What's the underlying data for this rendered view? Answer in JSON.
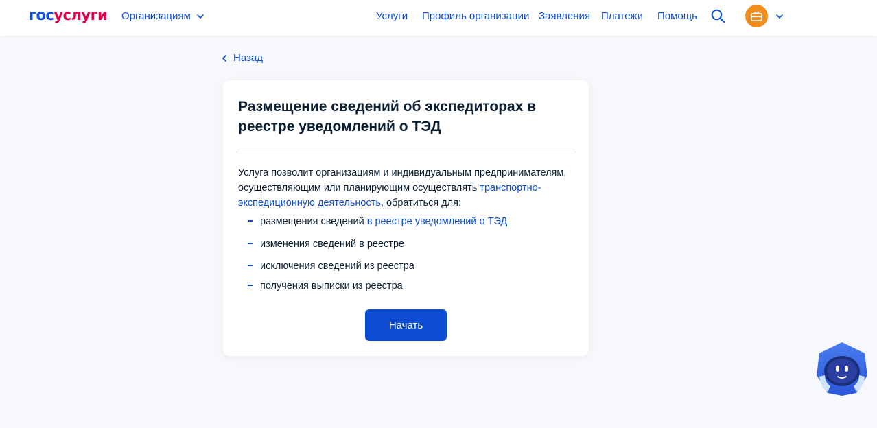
{
  "header": {
    "logo_part1": "гос",
    "logo_part2": "услуги",
    "org_menu_label": "Организациям",
    "nav": [
      {
        "label": "Услуги"
      },
      {
        "label": "Профиль организации"
      },
      {
        "label": "Заявления"
      },
      {
        "label": "Платежи"
      },
      {
        "label": "Помощь"
      }
    ],
    "search_icon": "search-icon",
    "avatar_icon": "briefcase-icon"
  },
  "back": {
    "label": "Назад"
  },
  "card": {
    "title": "Размещение сведений об экспедиторах в реестре уведомлений о ТЭД",
    "description_before_link": "Услуга позволит организациям и индивидуальным предпринимателям, осуществляющим или планирующим осуществлять ",
    "description_link": "транспортно-экспедиционную деятельность",
    "description_after_link": ", обратиться для:",
    "list": [
      {
        "text": "размещения сведений ",
        "link": "в реестре уведомлений о ТЭД"
      },
      {
        "text": "изменения сведений в реестре",
        "link": ""
      },
      {
        "text": "исключения сведений из реестра",
        "link": ""
      },
      {
        "text": "получения выписки из реестра",
        "link": ""
      }
    ],
    "start_button": "Начать"
  },
  "colors": {
    "accent": "#0d4cd3",
    "brand_red": "#e3004e",
    "avatar_orange": "#f28c1b",
    "text": "#0b1f33",
    "background": "#f6f8fb"
  },
  "assistant": {
    "icon": "robot-assistant-icon"
  }
}
